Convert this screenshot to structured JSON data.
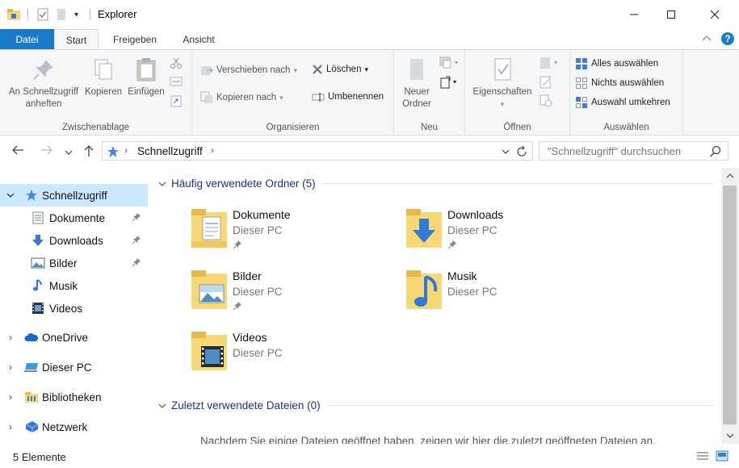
{
  "window": {
    "title": "Explorer",
    "minimize_icon": "minimize-icon",
    "maximize_icon": "maximize-icon",
    "close_icon": "close-icon"
  },
  "ribbon_tabs": [
    {
      "label": "Datei"
    },
    {
      "label": "Start"
    },
    {
      "label": "Freigeben"
    },
    {
      "label": "Ansicht"
    }
  ],
  "ribbon": {
    "zwischenablage": {
      "label": "Zwischenablage",
      "pin_label_1": "An Schnellzugriff",
      "pin_label_2": "anheften",
      "copy": "Kopieren",
      "paste": "Einfügen"
    },
    "organisieren": {
      "label": "Organisieren",
      "move": "Verschieben nach",
      "copy_to": "Kopieren nach",
      "delete": "Löschen",
      "rename": "Umbenennen"
    },
    "neu": {
      "label": "Neu",
      "new_folder_1": "Neuer",
      "new_folder_2": "Ordner"
    },
    "oeffnen": {
      "label": "Öffnen",
      "properties": "Eigenschaften"
    },
    "auswaehlen": {
      "label": "Auswählen",
      "select_all": "Alles auswählen",
      "select_none": "Nichts auswählen",
      "invert": "Auswahl umkehren"
    }
  },
  "address": {
    "path": "Schnellzugriff",
    "search_placeholder": "\"Schnellzugriff\" durchsuchen"
  },
  "nav": {
    "quick_access": "Schnellzugriff",
    "pinned": [
      {
        "label": "Dokumente"
      },
      {
        "label": "Downloads"
      },
      {
        "label": "Bilder"
      },
      {
        "label": "Musik"
      },
      {
        "label": "Videos"
      }
    ],
    "onedrive": "OneDrive",
    "this_pc": "Dieser PC",
    "libraries": "Bibliotheken",
    "network": "Netzwerk"
  },
  "content": {
    "frequent_header": "Häufig verwendete Ordner (5)",
    "recent_header": "Zuletzt verwendete Dateien (0)",
    "empty_message": "Nachdem Sie einige Dateien geöffnet haben, zeigen wir hier die zuletzt geöffneten Dateien an.",
    "folders": [
      {
        "name": "Dokumente",
        "location": "Dieser PC"
      },
      {
        "name": "Downloads",
        "location": "Dieser PC"
      },
      {
        "name": "Bilder",
        "location": "Dieser PC"
      },
      {
        "name": "Musik",
        "location": "Dieser PC"
      },
      {
        "name": "Videos",
        "location": "Dieser PC"
      }
    ]
  },
  "status": {
    "count": "5 Elemente"
  },
  "colors": {
    "accent": "#1979ca",
    "selection": "#cce8ff",
    "folder": "#f8d775",
    "header_blue": "#1e3287"
  }
}
